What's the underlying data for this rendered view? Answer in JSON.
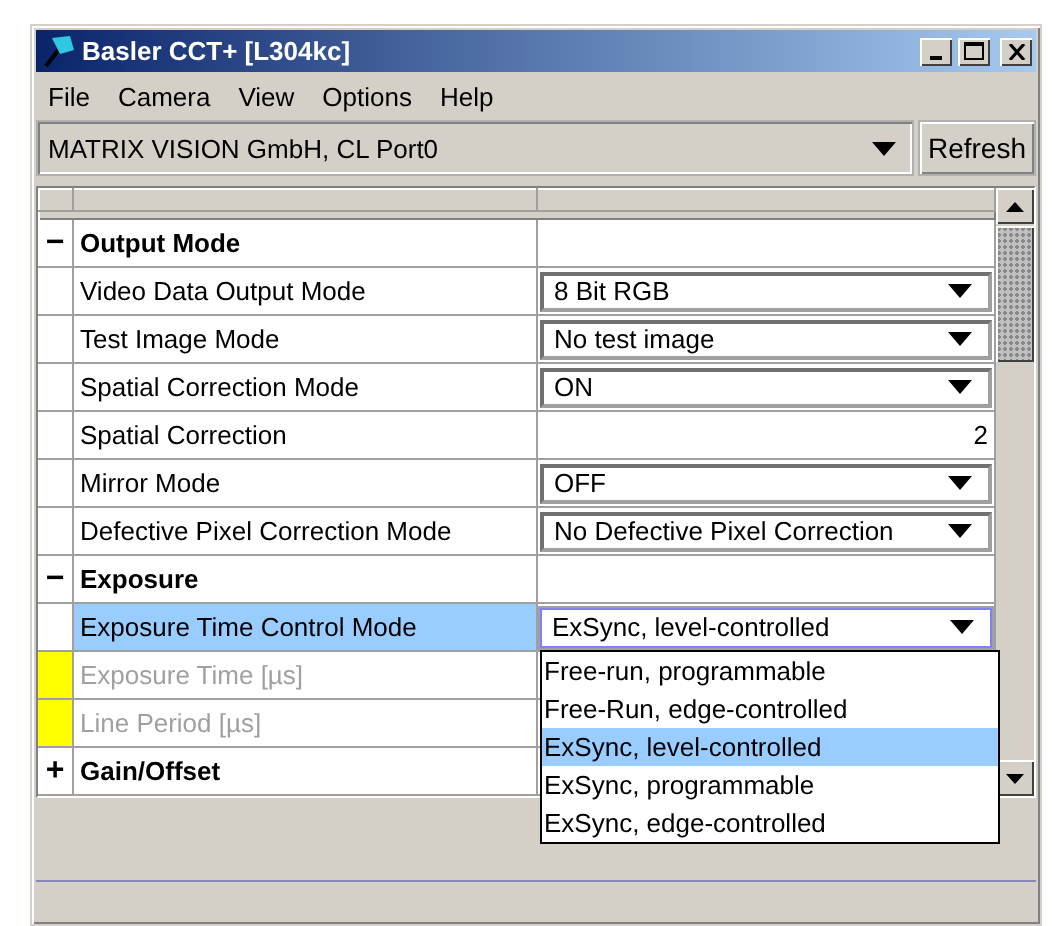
{
  "window": {
    "title": "Basler CCT+ [L304kc]"
  },
  "menu": [
    {
      "label": "File"
    },
    {
      "label": "Camera"
    },
    {
      "label": "View"
    },
    {
      "label": "Options"
    },
    {
      "label": "Help"
    }
  ],
  "device": {
    "value": "MATRIX VISION GmbH, CL Port0",
    "button": "Refresh"
  },
  "table": {
    "rows": [
      {
        "kind": "group",
        "name": "Output Mode",
        "toggle": "−",
        "selected": false
      },
      {
        "kind": "combo",
        "name": "Video Data Output Mode",
        "value": "8 Bit RGB",
        "selected": false,
        "disabled": false,
        "marked": false
      },
      {
        "kind": "combo",
        "name": "Test Image Mode",
        "value": "No test image",
        "selected": false,
        "disabled": false,
        "marked": false
      },
      {
        "kind": "combo",
        "name": "Spatial Correction Mode",
        "value": "ON",
        "selected": false,
        "disabled": false,
        "marked": false
      },
      {
        "kind": "number",
        "name": "Spatial Correction",
        "value": "2",
        "selected": false,
        "disabled": false,
        "marked": false
      },
      {
        "kind": "combo",
        "name": "Mirror Mode",
        "value": "OFF",
        "selected": false,
        "disabled": false,
        "marked": false
      },
      {
        "kind": "combo",
        "name": "Defective Pixel Correction Mode",
        "value": "No Defective Pixel Correction",
        "selected": false,
        "disabled": false,
        "marked": false
      },
      {
        "kind": "group",
        "name": "Exposure",
        "toggle": "−",
        "selected": false
      },
      {
        "kind": "combo",
        "name": "Exposure Time Control Mode",
        "value": "ExSync, level-controlled",
        "selected": true,
        "disabled": false,
        "marked": false
      },
      {
        "kind": "number",
        "name": "Exposure Time [µs]",
        "selected": false,
        "disabled": true,
        "marked": true
      },
      {
        "kind": "number",
        "name": "Line Period [µs]",
        "selected": false,
        "disabled": true,
        "marked": true
      },
      {
        "kind": "group",
        "name": "Gain/Offset",
        "toggle": "+",
        "selected": false
      }
    ]
  },
  "open_dropdown": {
    "options": [
      {
        "label": "Free-run, programmable",
        "selected": false
      },
      {
        "label": "Free-Run, edge-controlled",
        "selected": false
      },
      {
        "label": "ExSync, level-controlled",
        "selected": true
      },
      {
        "label": "ExSync, programmable",
        "selected": false
      },
      {
        "label": "ExSync, edge-controlled",
        "selected": false
      }
    ]
  }
}
